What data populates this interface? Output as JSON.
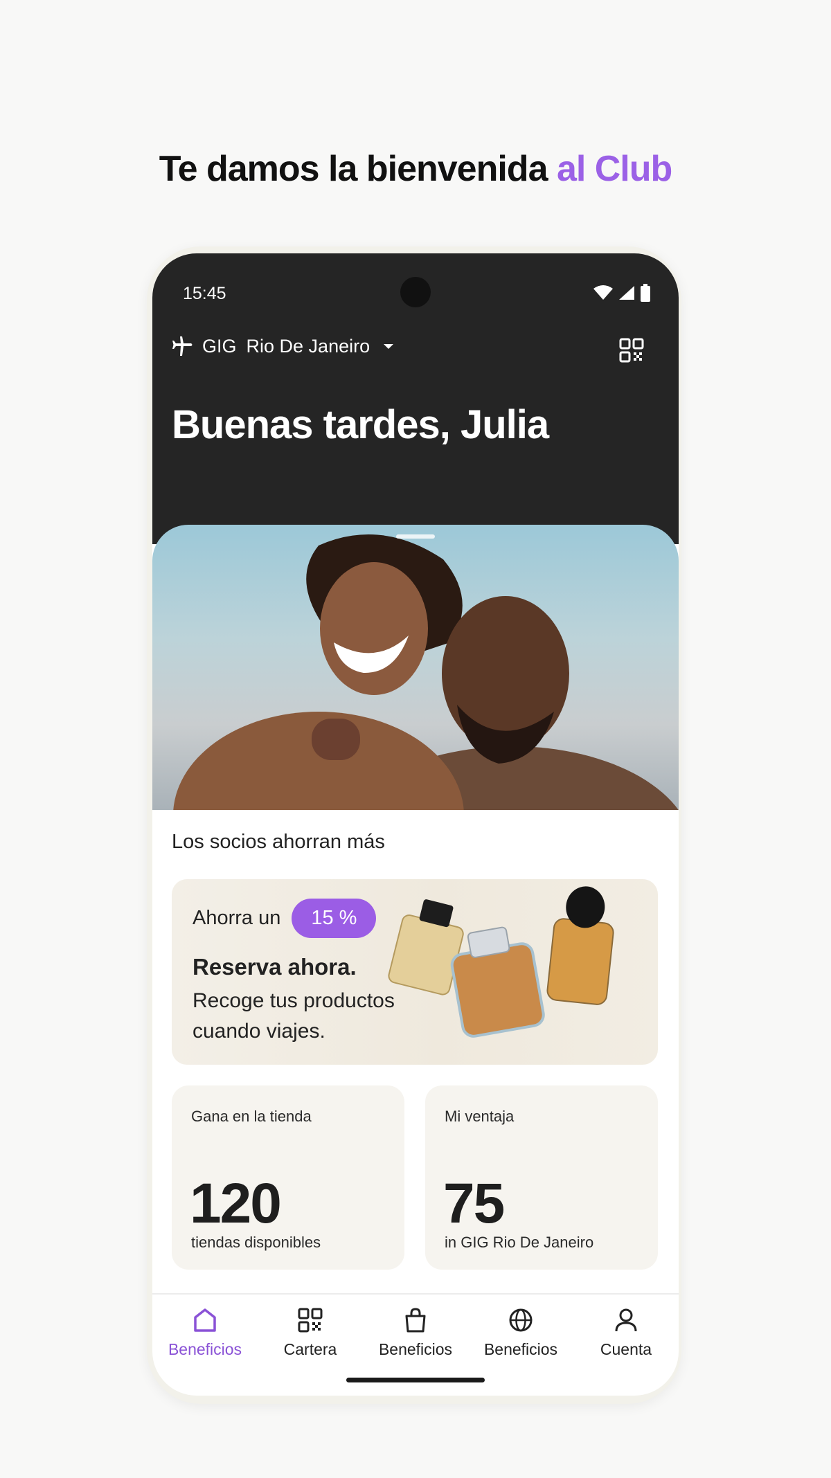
{
  "headline": {
    "text": "Te damos la bienvenida",
    "accent": "al Club"
  },
  "status_bar": {
    "time": "15:45"
  },
  "location": {
    "code": "GIG",
    "city": "Rio De Janeiro"
  },
  "greeting": "Buenas tardes, Julia",
  "section_title": "Los socios ahorran más",
  "promo": {
    "save_prefix": "Ahorra un",
    "discount": "15 %",
    "title": "Reserva ahora.",
    "body": "Recoge tus productos cuando viajes."
  },
  "stats": [
    {
      "label": "Gana en la tienda",
      "value": "120",
      "sub": "tiendas disponibles"
    },
    {
      "label": "Mi ventaja",
      "value": "75",
      "sub": "in GIG Rio De Janeiro"
    }
  ],
  "nav": [
    {
      "label": "Beneficios",
      "icon": "home-icon",
      "active": true
    },
    {
      "label": "Cartera",
      "icon": "qr-code-icon",
      "active": false
    },
    {
      "label": "Beneficios",
      "icon": "shopping-bag-icon",
      "active": false
    },
    {
      "label": "Beneficios",
      "icon": "globe-icon",
      "active": false
    },
    {
      "label": "Cuenta",
      "icon": "user-icon",
      "active": false
    }
  ],
  "colors": {
    "accent": "#9b61e6",
    "header_bg": "#252525",
    "badge": "#9b5de5"
  }
}
